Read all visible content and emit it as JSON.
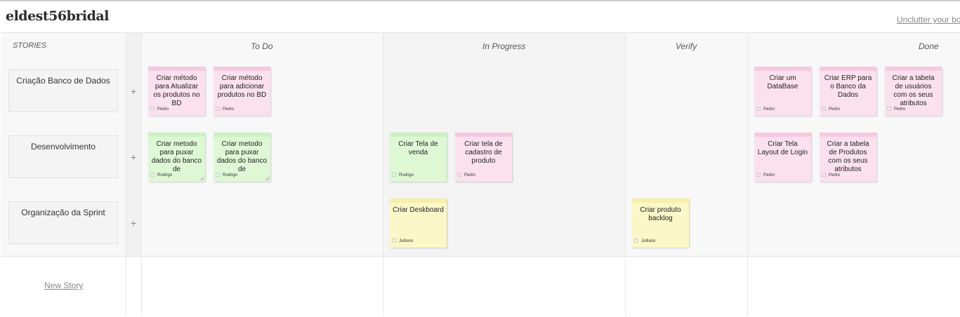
{
  "board": {
    "title": "eldest56bridal",
    "unclutter_label": "Unclutter your bo",
    "new_story_label": "New Story",
    "plus_label": "+"
  },
  "columns": {
    "stories": "STORIES",
    "todo": "To Do",
    "in_progress": "In Progress",
    "verify": "Verify",
    "done": "Done"
  },
  "stories": [
    {
      "title": "Criação Banco de Dados"
    },
    {
      "title": "Desenvolvimento"
    },
    {
      "title": "Organização da Sprint"
    }
  ],
  "cards": {
    "todo": [
      {
        "text": "Criar método para Atualizar os produtos no BD",
        "owner": "Pedro",
        "color": "#fbe1ee"
      },
      {
        "text": "Criar método para adicionar produtos no BD",
        "owner": "Pedro",
        "color": "#fbe1ee"
      },
      {
        "text": "Criar metodo para puxar dados do banco de",
        "owner": "Rodrigo",
        "color": "#def8d6"
      },
      {
        "text": "Criar metodo para puxar dados do banco de",
        "owner": "Rodrigo",
        "color": "#def8d6"
      }
    ],
    "in_progress": [
      {
        "text": "Criar Tela de venda",
        "owner": "Rodrigo",
        "color": "#def8d6"
      },
      {
        "text": "Criar tela de cadastro de produto",
        "owner": "Pedro",
        "color": "#fbe1ee"
      },
      {
        "text": "Criar Deskboard",
        "owner": "Julliano",
        "color": "#fbf7c8"
      }
    ],
    "verify": [
      {
        "text": "Criar produto backlog",
        "owner": "Julliano",
        "color": "#fbf7c8"
      }
    ],
    "done": [
      {
        "text": "Criar um DataBase",
        "owner": "Pedro",
        "color": "#fbe1ee"
      },
      {
        "text": "Criar ERP para o Banco da Dados",
        "owner": "Pedro",
        "color": "#fbe1ee"
      },
      {
        "text": "Criar a tabela de usuários com os seus atributos",
        "owner": "Pedro",
        "color": "#fbe1ee"
      },
      {
        "text": "Criar Tela Layout de Login",
        "owner": "Pedro",
        "color": "#fbe1ee"
      },
      {
        "text": "Criar a tabela de Produtos com os seus atributos",
        "owner": "Pedro",
        "color": "#fbe1ee"
      }
    ]
  }
}
